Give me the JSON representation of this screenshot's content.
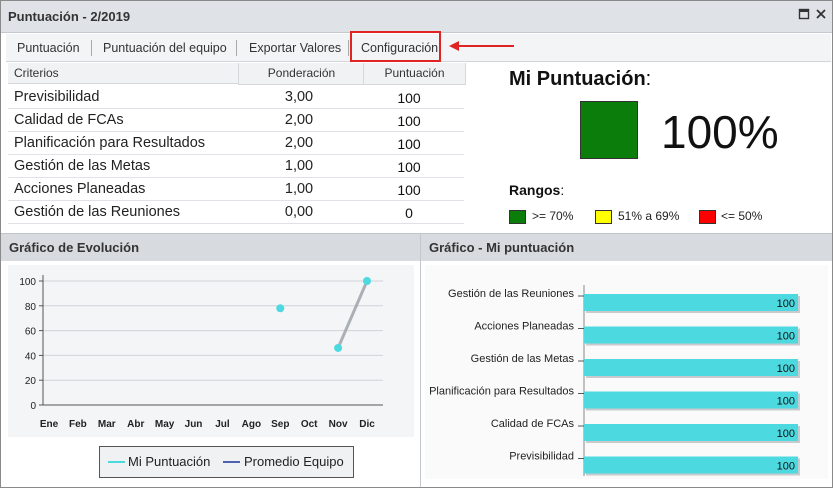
{
  "window": {
    "title": "Puntuación - 2/2019",
    "restore_icon": "restore-icon",
    "close_icon": "close-icon"
  },
  "toolbar": {
    "items": [
      "Puntuación",
      "Puntuación del equipo",
      "Exportar Valores",
      "Configuración"
    ]
  },
  "table": {
    "headers": [
      "Criterios",
      "Ponderación",
      "Puntuación"
    ],
    "rows": [
      {
        "criterio": "Previsibilidad",
        "ponderacion": "3,00",
        "puntuacion": "100"
      },
      {
        "criterio": "Calidad de FCAs",
        "ponderacion": "2,00",
        "puntuacion": "100"
      },
      {
        "criterio": "Planificación para Resultados",
        "ponderacion": "2,00",
        "puntuacion": "100"
      },
      {
        "criterio": "Gestión de las Metas",
        "ponderacion": "1,00",
        "puntuacion": "100"
      },
      {
        "criterio": "Acciones Planeadas",
        "ponderacion": "1,00",
        "puntuacion": "100"
      },
      {
        "criterio": "Gestión de las Reuniones",
        "ponderacion": "0,00",
        "puntuacion": "0"
      }
    ]
  },
  "mi_puntuacion": {
    "title": "Mi Puntuación",
    "colon": ":",
    "value": "100%",
    "color": "#0a7d0a",
    "rangos_title": "Rangos",
    "rangos_colon": ":",
    "rangos": [
      {
        "label": ">= 70%",
        "color": "#0a7d0a"
      },
      {
        "label": "51% a 69%",
        "color": "#ffff00"
      },
      {
        "label": "<= 50%",
        "color": "#ff0000"
      }
    ]
  },
  "panels": {
    "left_title": "Gráfico de Evolución",
    "right_title": "Gráfico - Mi puntuación"
  },
  "chart_data": [
    {
      "type": "line",
      "categories": [
        "Ene",
        "Feb",
        "Mar",
        "Abr",
        "May",
        "Jun",
        "Jul",
        "Ago",
        "Sep",
        "Oct",
        "Nov",
        "Dic"
      ],
      "ylim": [
        0,
        100
      ],
      "yticks": [
        "0",
        "20",
        "40",
        "60",
        "80",
        "100"
      ],
      "series": [
        {
          "name": "Mi Puntuación",
          "color": "#4dd9e0",
          "values": [
            null,
            null,
            null,
            null,
            null,
            null,
            null,
            null,
            78,
            null,
            46,
            100
          ]
        },
        {
          "name": "Promedio Equipo",
          "color": "#5060b0",
          "values": []
        }
      ],
      "legend": "bottom"
    },
    {
      "type": "bar",
      "orientation": "horizontal",
      "categories": [
        "Gestión de las Reuniones",
        "Acciones Planeadas",
        "Gestión de las Metas",
        "Planificación para Resultados",
        "Calidad de FCAs",
        "Previsibilidad"
      ],
      "values": [
        100,
        100,
        100,
        100,
        100,
        100
      ],
      "labels": [
        "100",
        "100",
        "100",
        "100",
        "100",
        "100"
      ],
      "color": "#4dd9e0"
    }
  ]
}
